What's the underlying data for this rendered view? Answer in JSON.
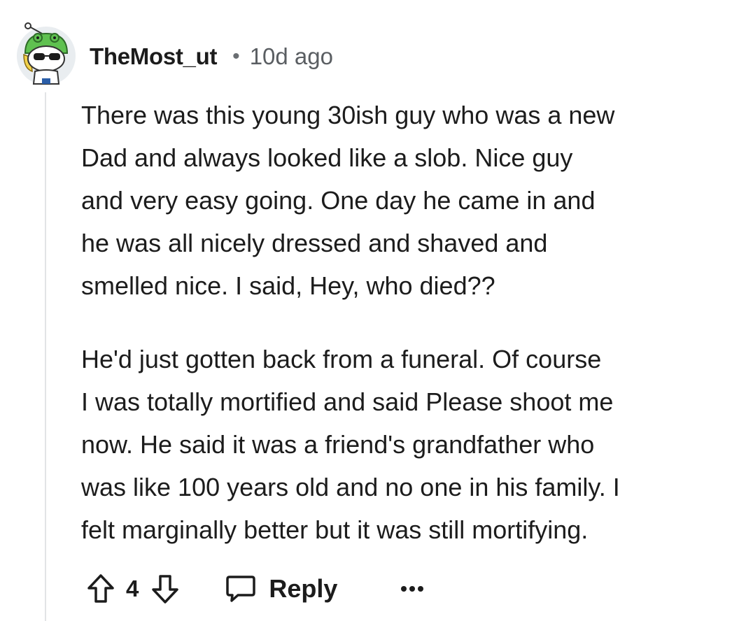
{
  "comment": {
    "avatar_icon": "snoo-avatar-frog-hat-sunglasses",
    "username": "TheMost_ut",
    "separator": "•",
    "timestamp": "10d ago",
    "paragraphs": [
      "There was this young 30ish guy who was a new\nDad and always looked like a slob. Nice guy\nand very easy going. One day he came in and\nhe was all nicely dressed and shaved and\nsmelled nice. I said, Hey, who died??",
      "He'd just gotten back from a funeral. Of course\nI was totally mortified and said Please shoot me\nnow. He said it was a friend's grandfather who\nwas like 100 years old and no one in his family. I\nfelt marginally better but it was still mortifying."
    ],
    "actions": {
      "upvote_icon": "upvote-arrow-icon",
      "score": "4",
      "downvote_icon": "downvote-arrow-icon",
      "reply_icon": "speech-bubble-icon",
      "reply_label": "Reply",
      "more_icon": "ellipsis-icon"
    }
  },
  "colors": {
    "text": "#1c1c1c",
    "muted": "#5a5e62",
    "thread_line": "#e2e4e6",
    "avatar_bg": "#e9edf0",
    "avatar_hat": "#5fc150"
  }
}
